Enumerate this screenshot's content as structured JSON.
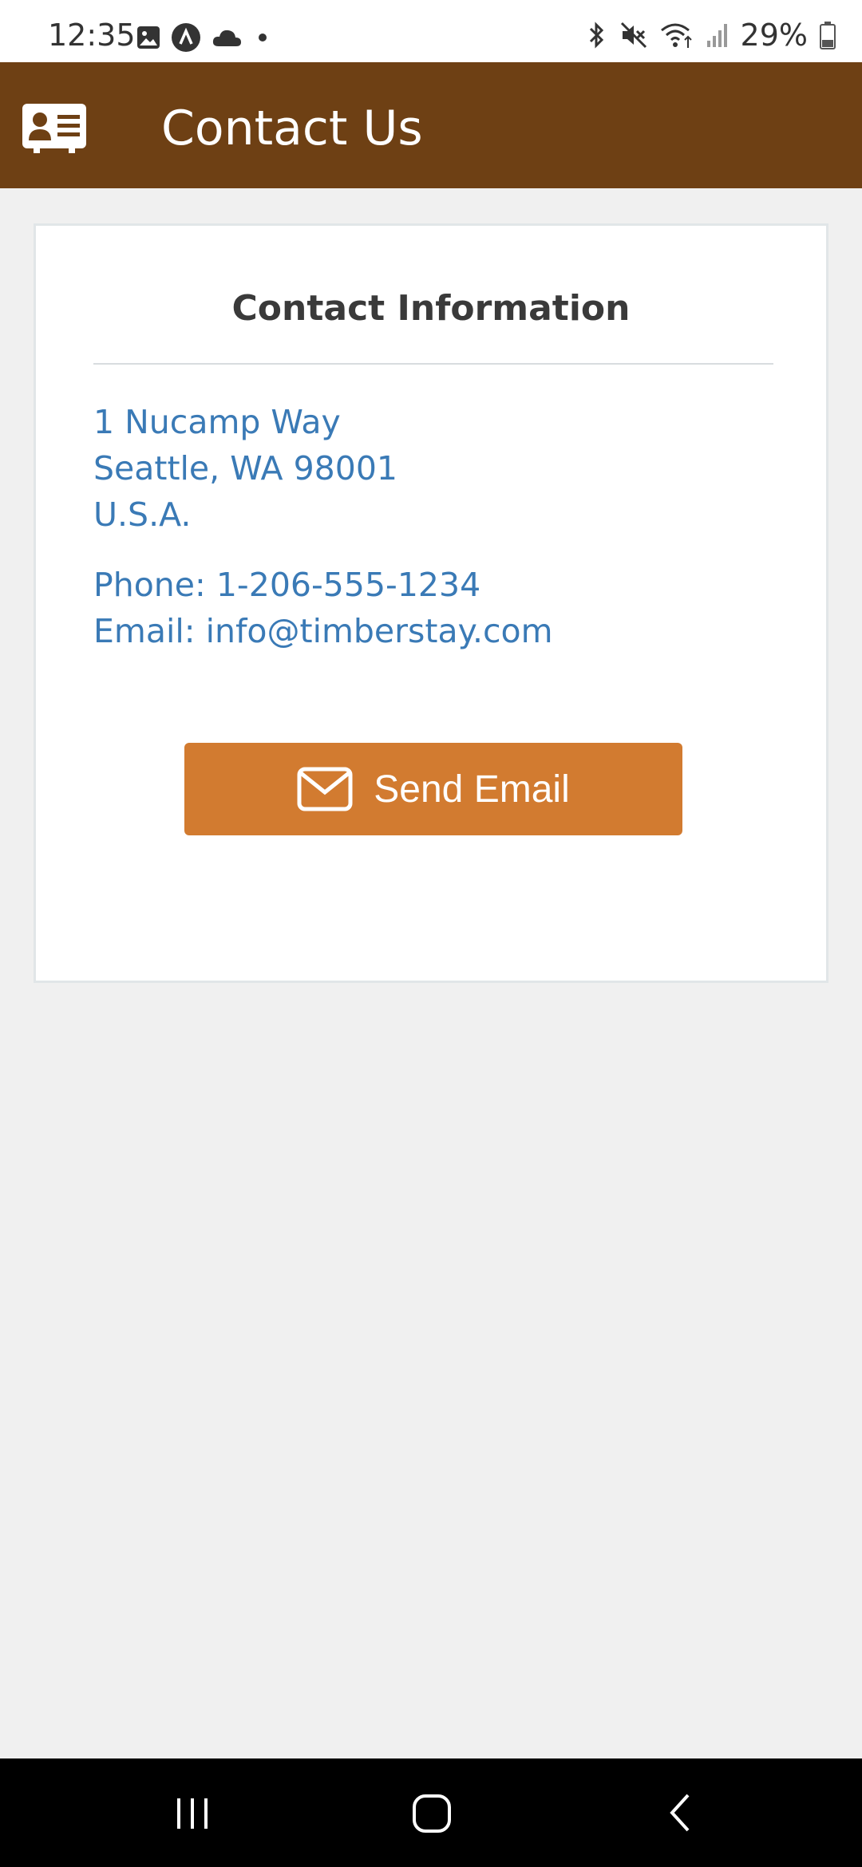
{
  "status_bar": {
    "time": "12:35",
    "battery": "29%",
    "icons_left": [
      "gallery-icon",
      "app-icon",
      "cloud-icon",
      "dot-icon"
    ],
    "icons_right": [
      "bluetooth-icon",
      "mute-icon",
      "wifi-icon",
      "signal-icon",
      "battery-icon"
    ]
  },
  "app_bar": {
    "title": "Contact Us",
    "icon": "contact-card-icon",
    "color": "#6e4014"
  },
  "card": {
    "title": "Contact Information",
    "address_line1": "1 Nucamp Way",
    "address_line2": "Seattle, WA 98001",
    "address_line3": "U.S.A.",
    "phone": "Phone: 1-206-555-1234",
    "email": "Email: info@timberstay.com",
    "link_color": "#3a7ab6"
  },
  "send_button": {
    "label": "Send Email",
    "icon": "envelope-icon",
    "color": "#d27b30"
  },
  "nav_bar": {
    "items": [
      "recents-icon",
      "home-icon",
      "back-icon"
    ]
  }
}
